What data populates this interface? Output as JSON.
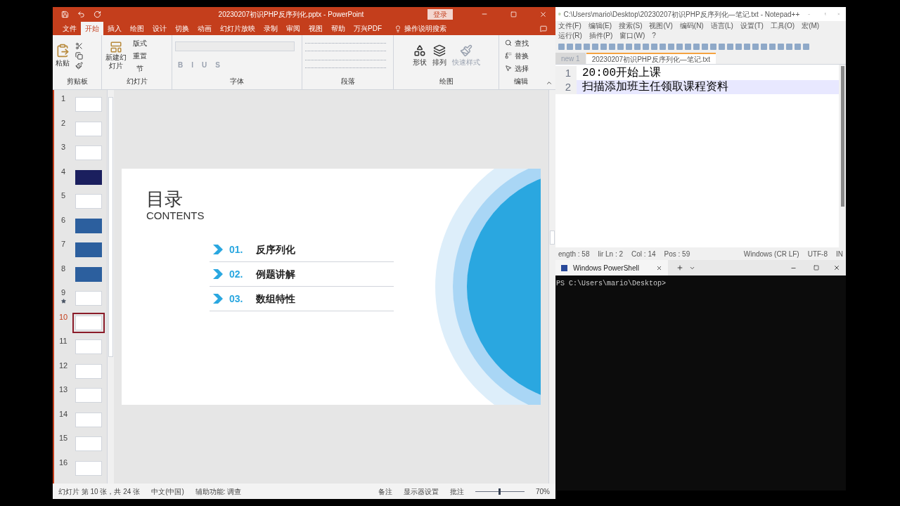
{
  "powerpoint": {
    "title": "20230207初识PHP反序列化.pptx - PowerPoint",
    "login": "登录",
    "tabs": [
      {
        "label": "文件",
        "selected": false
      },
      {
        "label": "开始",
        "selected": true
      },
      {
        "label": "插入",
        "selected": false
      },
      {
        "label": "绘图",
        "selected": false
      },
      {
        "label": "设计",
        "selected": false
      },
      {
        "label": "切换",
        "selected": false
      },
      {
        "label": "动画",
        "selected": false
      },
      {
        "label": "幻灯片放映",
        "selected": false
      },
      {
        "label": "录制",
        "selected": false
      },
      {
        "label": "审阅",
        "selected": false
      },
      {
        "label": "视图",
        "selected": false
      },
      {
        "label": "帮助",
        "selected": false
      },
      {
        "label": "万兴PDF",
        "selected": false
      }
    ],
    "tell_me": "操作说明搜索",
    "ribbon": {
      "paste": "粘贴",
      "clipboard": "剪贴板",
      "new_slide": "新建幻灯片",
      "layout": "版式",
      "reset": "重置",
      "section": "节",
      "slides": "幻灯片",
      "font_buttons": [
        "B",
        "I",
        "U",
        "S"
      ],
      "font": "字体",
      "paragraph": "段落",
      "shape": "形状",
      "arrange": "排列",
      "quick_style": "快速样式",
      "drawing": "绘图",
      "find": "查找",
      "replace": "替换",
      "select": "选择",
      "editing": "编辑"
    },
    "slides": [
      {
        "number": "1",
        "kind": "light",
        "selected": false,
        "starred": false
      },
      {
        "number": "2",
        "kind": "light",
        "selected": false,
        "starred": false
      },
      {
        "number": "3",
        "kind": "light",
        "selected": false,
        "starred": false
      },
      {
        "number": "4",
        "kind": "navy",
        "selected": false,
        "starred": false
      },
      {
        "number": "5",
        "kind": "light",
        "selected": false,
        "starred": false
      },
      {
        "number": "6",
        "kind": "blue",
        "selected": false,
        "starred": false
      },
      {
        "number": "7",
        "kind": "blue",
        "selected": false,
        "starred": false
      },
      {
        "number": "8",
        "kind": "blue",
        "selected": false,
        "starred": false
      },
      {
        "number": "9",
        "kind": "light",
        "selected": false,
        "starred": true
      },
      {
        "number": "10",
        "kind": "light",
        "selected": true,
        "starred": false
      },
      {
        "number": "11",
        "kind": "light",
        "selected": false,
        "starred": false
      },
      {
        "number": "12",
        "kind": "light",
        "selected": false,
        "starred": false
      },
      {
        "number": "13",
        "kind": "light",
        "selected": false,
        "starred": false
      },
      {
        "number": "14",
        "kind": "light",
        "selected": false,
        "starred": false
      },
      {
        "number": "15",
        "kind": "light",
        "selected": false,
        "starred": false
      },
      {
        "number": "16",
        "kind": "light",
        "selected": false,
        "starred": false
      }
    ],
    "slide": {
      "title": "目录",
      "subtitle": "CONTENTS",
      "items": [
        {
          "number": "01.",
          "text": "反序列化"
        },
        {
          "number": "02.",
          "text": "例题讲解"
        },
        {
          "number": "03.",
          "text": "数组特性"
        }
      ]
    },
    "status_bar": {
      "left": [
        "幻灯片 第 10 张，共 24 张",
        "中文(中国)",
        "辅助功能: 调查"
      ],
      "notes": "备注",
      "display": "显示器设置",
      "comments": "批注",
      "zoom": "70%",
      "level": 0.5
    }
  },
  "notepad": {
    "title": "C:\\Users\\mario\\Desktop\\20230207初识PHP反序列化—笔记.txt - Notepad++",
    "menu": [
      "文件(F)",
      "编辑(E)",
      "搜索(S)",
      "视图(V)",
      "编码(N)",
      "语言(L)",
      "设置(T)",
      "工具(O)",
      "宏(M)",
      "运行(R)",
      "插件(P)",
      "窗口(W)",
      "?"
    ],
    "tabs": [
      {
        "label": "new 1",
        "selected": false
      },
      {
        "label": "20230207初识PHP反序列化—笔记.txt",
        "selected": true
      }
    ],
    "lines": [
      {
        "number": "1",
        "text": "20:00开始上课",
        "selected": false
      },
      {
        "number": "2",
        "text": "扫描添加班主任领取课程资料",
        "selected": true
      }
    ],
    "status_bar": [
      "ength : 58",
      "lir Ln : 2",
      "Col : 14",
      "Pos : 59",
      "Windows (CR LF)",
      "UTF-8",
      "IN"
    ]
  },
  "powershell": {
    "tab": "Windows PowerShell",
    "prompt": "PS C:\\Users\\mario\\Desktop>"
  }
}
